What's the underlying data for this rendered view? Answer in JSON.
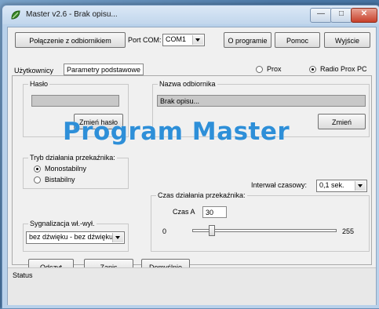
{
  "window": {
    "title": "Master v2.6 - Brak opisu...",
    "minimize_glyph": "—",
    "maximize_glyph": "□",
    "close_glyph": "✕",
    "icon": "app-leaf-icon"
  },
  "toolbar": {
    "connect_label": "Połączenie z odbiornikiem",
    "port_label": "Port COM:",
    "port_value": "COM1",
    "about_label": "O programie",
    "help_label": "Pomoc",
    "exit_label": "Wyjście"
  },
  "tabs": {
    "users_label": "Użytkownicy",
    "params_label": "Parametry podstawowe"
  },
  "mode": {
    "prox_label": "Prox",
    "prox_selected": false,
    "radio_prox_pc_label": "Radio Prox PC",
    "radio_prox_pc_selected": true
  },
  "password_group": {
    "caption": "Hasło",
    "value": "",
    "change_label": "Zmień hasło"
  },
  "receiver_group": {
    "caption": "Nazwa odbiornika",
    "value": "Brak opisu...",
    "change_label": "Zmień"
  },
  "relay_mode_group": {
    "caption": "Tryb działania przekaźnika:",
    "options": [
      {
        "label": "Monostabilny",
        "selected": true
      },
      {
        "label": "Bistabilny",
        "selected": false
      }
    ]
  },
  "interval": {
    "label": "Interwał czasowy:",
    "value": "0,1 sek."
  },
  "relay_time_group": {
    "caption": "Czas działania przekaźnika:",
    "time_label": "Czas A",
    "time_value": "30",
    "slider_min": "0",
    "slider_max": "255",
    "slider_value": 30
  },
  "signal_group": {
    "caption": "Sygnalizacja wł.-wył.",
    "value": "bez dźwięku - bez dźwięku"
  },
  "actions": {
    "read_label": "Odczyt",
    "write_label": "Zapis",
    "default_label": "Domyślnie"
  },
  "status": {
    "caption": "Status"
  },
  "overlay": {
    "text": "Program Master"
  },
  "colors": {
    "overlay_text": "#2e8fd8",
    "disabled_field": "#c8c8c8",
    "close_button": "#c8402a"
  }
}
